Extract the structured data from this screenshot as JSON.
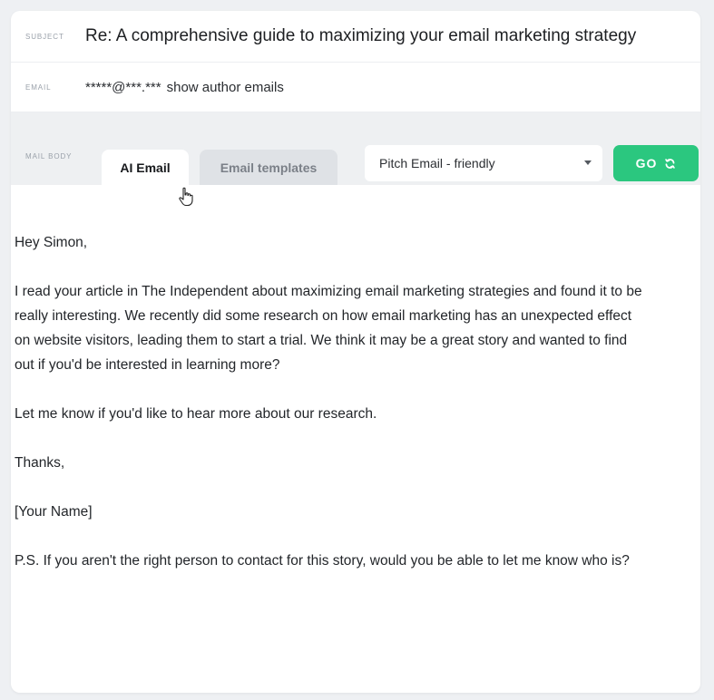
{
  "subject": {
    "label": "SUBJECT",
    "value": "Re: A comprehensive guide to maximizing your email marketing strategy"
  },
  "email": {
    "label": "EMAIL",
    "masked_value": "*****@***.***",
    "show_link": "show author emails"
  },
  "mail_body": {
    "label": "MAIL BODY",
    "tabs": [
      {
        "label": "AI Email",
        "active": true
      },
      {
        "label": "Email templates",
        "active": false
      }
    ],
    "template_select": {
      "selected": "Pitch Email - friendly"
    },
    "go_button": {
      "label": "GO",
      "icon": "refresh-icon",
      "color": "#2bc77f"
    }
  },
  "message": {
    "greeting": "Hey Simon,",
    "paragraph_1": "I read your article in The Independent about maximizing email marketing strategies and found it to be really interesting. We recently did some research on how email marketing has an unexpected effect on website visitors, leading them to start a trial. We think it may be a great story and wanted to find out if you'd be interested in learning more?",
    "paragraph_2": "Let me know if you'd like to hear more about our research.",
    "signoff": "Thanks,",
    "name_placeholder": "[Your Name]",
    "postscript": "P.S. If you aren't the right person to contact for this story, would you be able to let me know who is?"
  }
}
